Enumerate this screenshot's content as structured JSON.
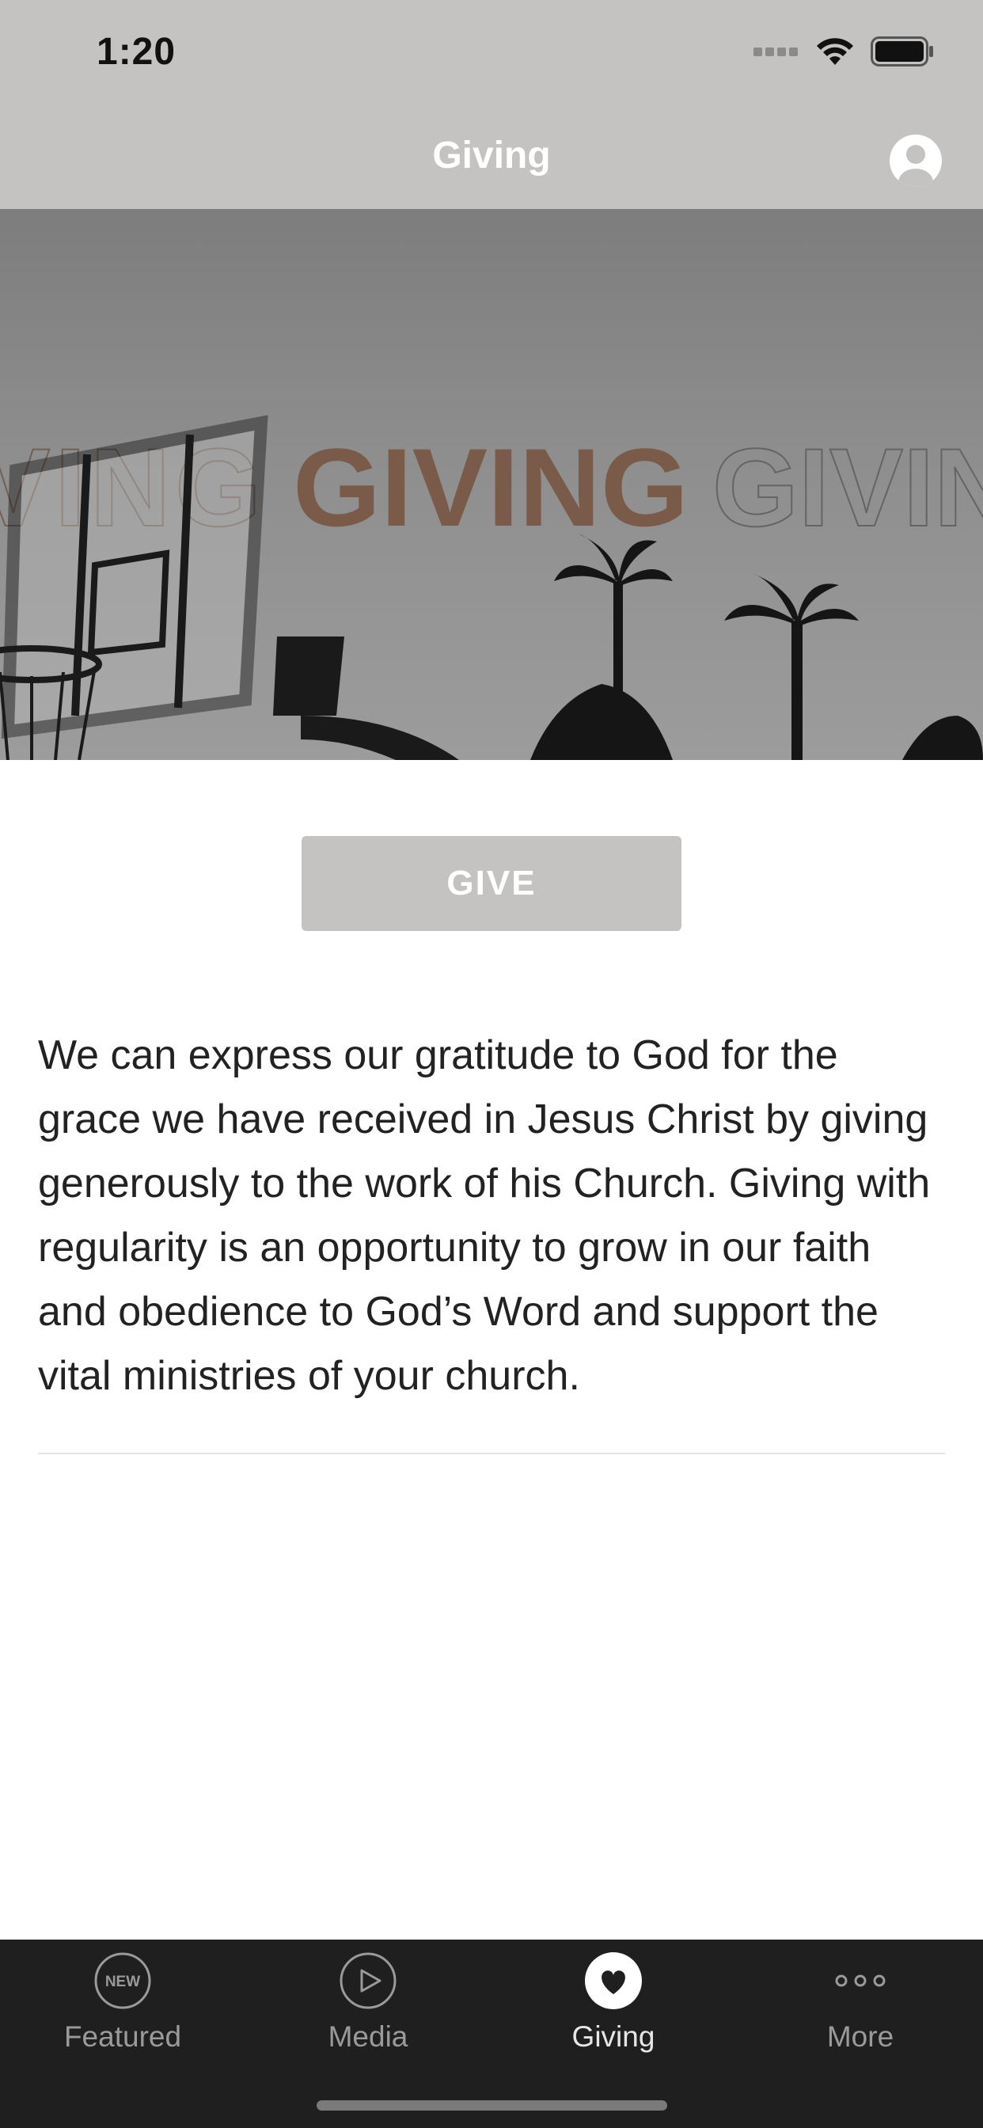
{
  "status_bar": {
    "time": "1:20"
  },
  "nav": {
    "title": "Giving",
    "profile_icon": "profile-icon"
  },
  "hero": {
    "banner_text": "GIVING",
    "accent_color": "#7a5a48"
  },
  "give_button": {
    "label": "GIVE",
    "color": "#c4c3c1"
  },
  "description": "We can express our gratitude to God for the grace we have received in Jesus Christ by giving generously to the work of his Church. Giving with regularity is an opportunity to grow in our faith and obedience to God’s Word and support the vital ministries of your church.",
  "tab_bar": {
    "tabs": [
      {
        "label": "Featured",
        "icon": "new-badge-icon",
        "active": false
      },
      {
        "label": "Media",
        "icon": "play-circle-icon",
        "active": false
      },
      {
        "label": "Giving",
        "icon": "heart-icon",
        "active": true
      },
      {
        "label": "More",
        "icon": "more-dots-icon",
        "active": false
      }
    ],
    "featured_badge": "NEW"
  }
}
